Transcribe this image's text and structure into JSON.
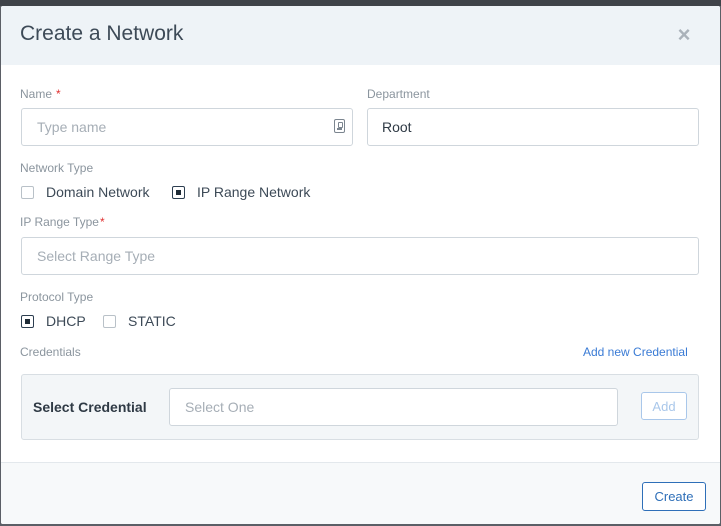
{
  "modal": {
    "title": "Create a Network",
    "close_glyph": "×"
  },
  "form": {
    "name": {
      "label": "Name",
      "required_mark": "*",
      "placeholder": "Type name",
      "value": ""
    },
    "department": {
      "label": "Department",
      "value": "Root"
    },
    "network_type": {
      "label": "Network Type",
      "options": [
        {
          "label": "Domain Network",
          "checked": false
        },
        {
          "label": "IP Range Network",
          "checked": true
        }
      ]
    },
    "ip_range_type": {
      "label": "IP Range Type",
      "required_mark": "*",
      "placeholder": "Select Range Type"
    },
    "protocol_type": {
      "label": "Protocol Type",
      "options": [
        {
          "label": "DHCP",
          "checked": true
        },
        {
          "label": "STATIC",
          "checked": false
        }
      ]
    },
    "credentials": {
      "label": "Credentials",
      "add_link": "Add new Credential",
      "select_label": "Select Credential",
      "select_placeholder": "Select One",
      "add_button": "Add"
    }
  },
  "footer": {
    "create_button": "Create"
  },
  "colors": {
    "header_bg": "#eef3f7",
    "link": "#3a7bd5",
    "primary_border": "#2e6fb8",
    "required": "#e03131"
  },
  "icons": {
    "name_field": "contact-card-icon",
    "close": "close-icon"
  }
}
